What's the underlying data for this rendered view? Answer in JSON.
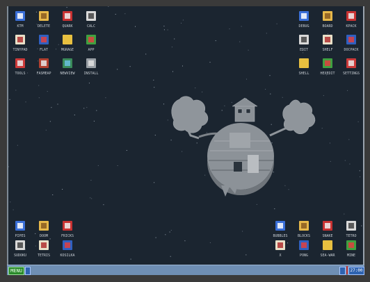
{
  "desktop": {
    "background": "#1b2530",
    "icons_top_left": [
      {
        "label": "KTM",
        "icon": "floppy-disk-icon"
      },
      {
        "label": "DELETE",
        "icon": "trash-bin-icon"
      },
      {
        "label": "QUARK",
        "icon": "book-icon"
      },
      {
        "label": "CALC",
        "icon": "calculator-icon"
      },
      {
        "label": "TINYPAD",
        "icon": "notepad-icon"
      },
      {
        "label": "FLAT",
        "icon": "grid-icon"
      },
      {
        "label": "MGRAGE",
        "icon": "cross-tools-icon"
      },
      {
        "label": "APP",
        "icon": "cube-icon"
      },
      {
        "label": "TOOLS",
        "icon": "toolbox-icon"
      },
      {
        "label": "FASMEAP",
        "icon": "red-book-icon"
      },
      {
        "label": "NEWVIEW",
        "icon": "image-viewer-icon"
      },
      {
        "label": "INSTALL",
        "icon": "install-icon"
      }
    ],
    "icons_top_right": [
      {
        "label": "DEBUG",
        "icon": "debug-icon"
      },
      {
        "label": "BOARD",
        "icon": "board-icon"
      },
      {
        "label": "KPACK",
        "icon": "hammer-icon"
      },
      {
        "label": "EDIT",
        "icon": "blue-book-icon"
      },
      {
        "label": "SHELF",
        "icon": "drive-icon"
      },
      {
        "label": "DOCPACK",
        "icon": "document-pack-icon"
      },
      {
        "label": "SHELL",
        "icon": "terminal-icon"
      },
      {
        "label": "HEXEDIT",
        "icon": "hex-editor-icon"
      },
      {
        "label": "SETTINGS",
        "icon": "settings-panel-icon"
      }
    ],
    "icons_bottom_left": [
      {
        "label": "PIPES",
        "icon": "pipes-icon"
      },
      {
        "label": "DOOM",
        "icon": "doom-icon"
      },
      {
        "label": "FRICKS",
        "icon": "blocks-icon"
      },
      {
        "label": "SUDOKU",
        "icon": "sudoku-icon"
      },
      {
        "label": "TETRIS",
        "icon": "grid-game-icon"
      },
      {
        "label": "KOSILKA",
        "icon": "mower-icon"
      }
    ],
    "icons_bottom_right": [
      {
        "label": "BUBBLES",
        "icon": "bubbles-icon"
      },
      {
        "label": "BLOCKS",
        "icon": "colored-blocks-icon"
      },
      {
        "label": "SNAKE",
        "icon": "snake-icon"
      },
      {
        "label": "TETRO",
        "icon": "puzzle-icon"
      },
      {
        "label": "X",
        "icon": "green-grid-icon"
      },
      {
        "label": "PONG",
        "icon": "pong-icon"
      },
      {
        "label": "SEA-WAR",
        "icon": "sea-war-icon"
      },
      {
        "label": "MINE",
        "icon": "mine-icon"
      }
    ]
  },
  "taskbar": {
    "menu_label": "MENU",
    "clock": "27:00",
    "color": "#6f8fb4",
    "accent": "#2a8a2a"
  }
}
